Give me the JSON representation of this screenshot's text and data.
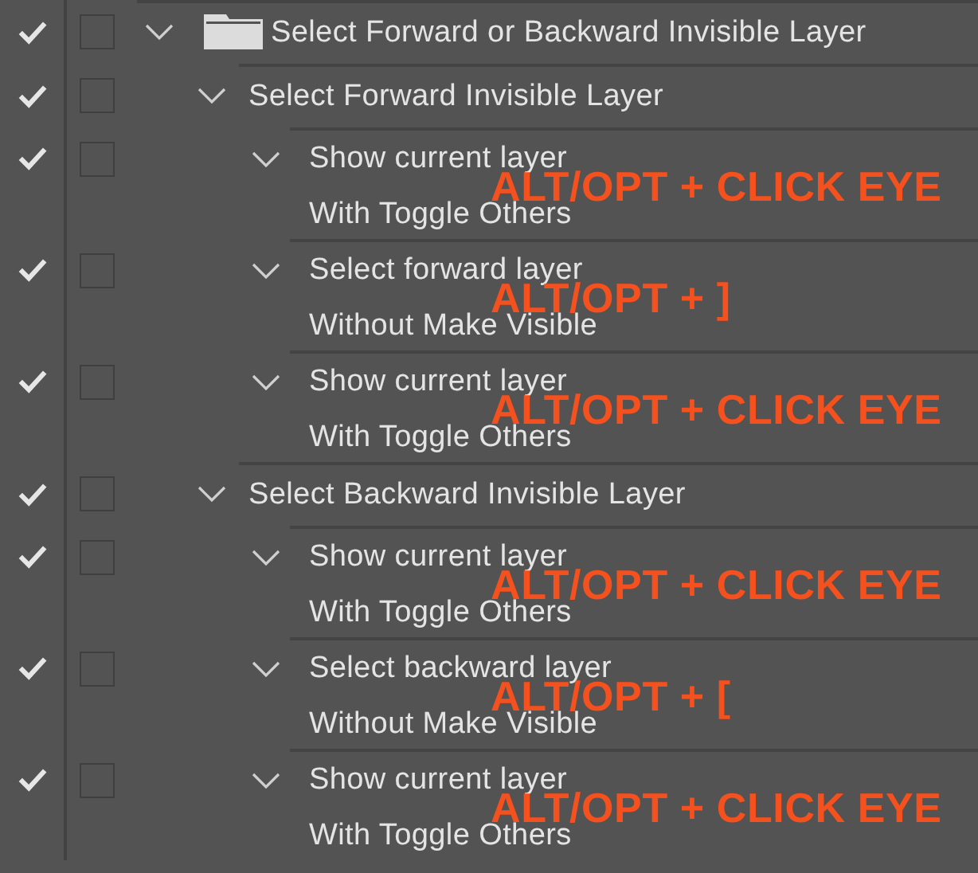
{
  "actions": [
    {
      "kind": "set",
      "label": "Select Forward or Backward Invisible Layer",
      "checked": true,
      "expanded": true,
      "children": [
        {
          "label": "Select Forward Invisible Layer",
          "checked": true,
          "expanded": true,
          "children": [
            {
              "label": "Show current layer",
              "detail": "With Toggle Others",
              "annotation": "ALT/OPT + CLICK EYE",
              "checked": true,
              "expanded": true
            },
            {
              "label": "Select forward layer",
              "detail": "Without Make Visible",
              "annotation": "ALT/OPT + ]",
              "checked": true,
              "expanded": true
            },
            {
              "label": "Show current layer",
              "detail": "With Toggle Others",
              "annotation": "ALT/OPT + CLICK EYE",
              "checked": true,
              "expanded": true
            }
          ]
        },
        {
          "label": "Select Backward Invisible Layer",
          "checked": true,
          "expanded": true,
          "children": [
            {
              "label": "Show current layer",
              "detail": "With Toggle Others",
              "annotation": "ALT/OPT + CLICK EYE",
              "checked": true,
              "expanded": true
            },
            {
              "label": "Select backward layer",
              "detail": "Without Make Visible",
              "annotation": "ALT/OPT + [",
              "checked": true,
              "expanded": true
            },
            {
              "label": "Show current layer",
              "detail": "With Toggle Others",
              "annotation": "ALT/OPT + CLICK EYE",
              "checked": true,
              "expanded": true
            }
          ]
        }
      ]
    }
  ]
}
